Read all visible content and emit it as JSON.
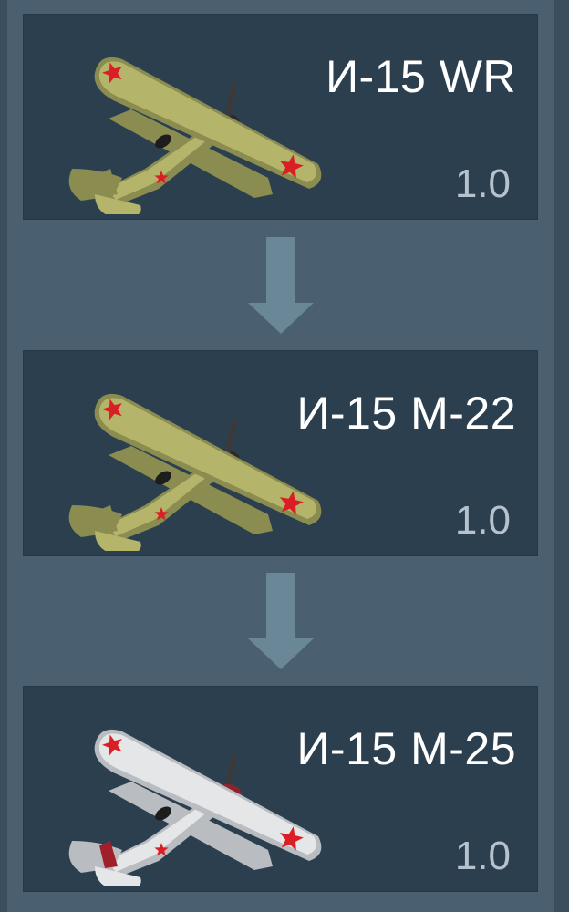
{
  "research_tree": {
    "vehicles": [
      {
        "name": "И-15 WR",
        "br": "1.0",
        "camo": "green",
        "body_color": "#b4b56a",
        "shade_color": "#8b8c4f",
        "accent_color": "#7a7d45"
      },
      {
        "name": "И-15 М-22",
        "br": "1.0",
        "camo": "green",
        "body_color": "#b4b56a",
        "shade_color": "#8b8c4f",
        "accent_color": "#7a7d45"
      },
      {
        "name": "И-15 М-25",
        "br": "1.0",
        "camo": "winter-white",
        "body_color": "#e4e6e8",
        "shade_color": "#b9bcc0",
        "accent_color": "#a0202a"
      }
    ]
  },
  "colors": {
    "background": "#3b4e5e",
    "card": "#2c3f4f",
    "arrow": "#6a8797",
    "star": "#d91f25"
  }
}
